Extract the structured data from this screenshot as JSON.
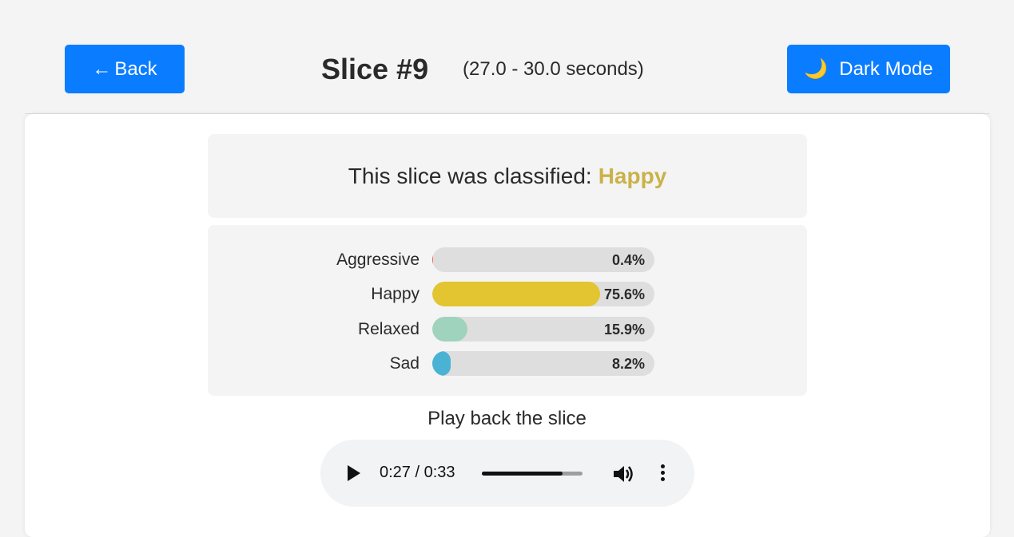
{
  "header": {
    "back_label": "Back",
    "back_arrow": "←",
    "title": "Slice #9",
    "range": "(27.0 - 30.0 seconds)",
    "dark_mode_label": "Dark Mode",
    "dark_mode_icon": "🌙"
  },
  "classification": {
    "prefix": "This slice was classified:",
    "label": "Happy",
    "label_color": "#c9b24a"
  },
  "moods": [
    {
      "name": "Aggressive",
      "value": 0.4,
      "pct": "0.4%",
      "color": "#e8605a"
    },
    {
      "name": "Happy",
      "value": 75.6,
      "pct": "75.6%",
      "color": "#e2c530"
    },
    {
      "name": "Relaxed",
      "value": 15.9,
      "pct": "15.9%",
      "color": "#9fd3bd"
    },
    {
      "name": "Sad",
      "value": 8.2,
      "pct": "8.2%",
      "color": "#4ab3d4"
    }
  ],
  "playback": {
    "label": "Play back the slice",
    "time": "0:27 / 0:33",
    "progress": 0.8
  },
  "colors": {
    "accent": "#0a7cff"
  }
}
